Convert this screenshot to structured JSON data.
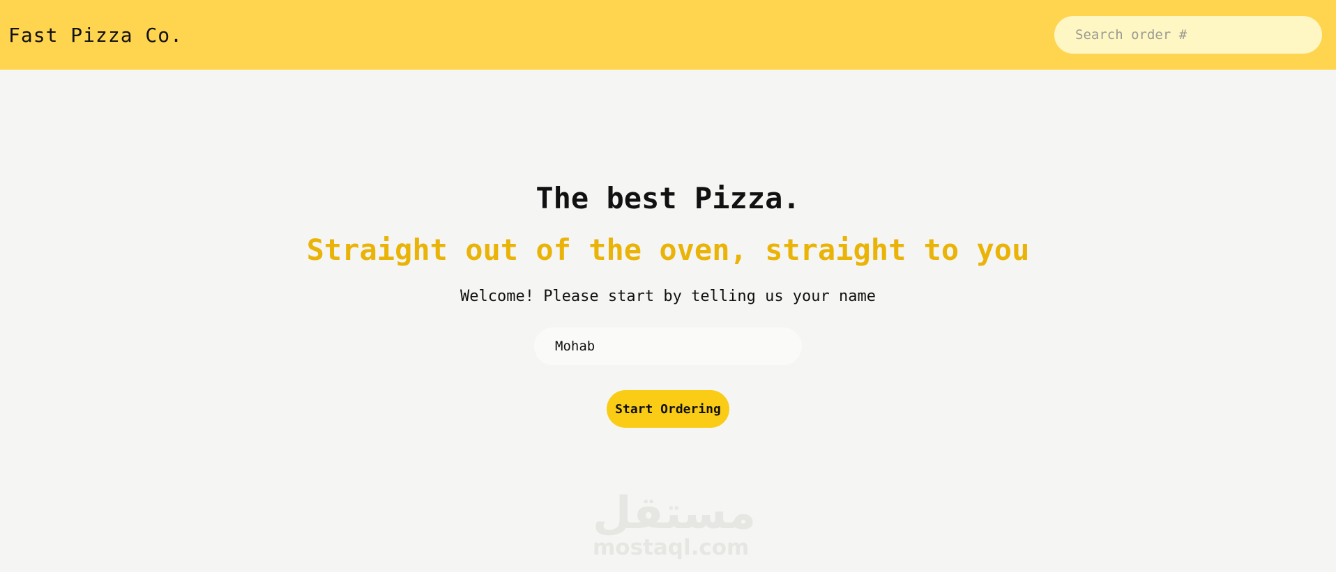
{
  "header": {
    "logo": "Fast Pizza Co.",
    "search_placeholder": "Search order #"
  },
  "hero": {
    "title": "The best Pizza.",
    "subtitle": "Straight out of the oven, straight to you"
  },
  "form": {
    "prompt": "Welcome! Please start by telling us your name",
    "name_value": "Mohab",
    "button_label": "Start Ordering"
  },
  "watermark": {
    "arabic": "مستقل",
    "latin": "mostaql.com"
  },
  "colors": {
    "header_bg": "#ffd54f",
    "accent": "#eab308",
    "button": "#facc15",
    "page_bg": "#f5f5f4"
  }
}
